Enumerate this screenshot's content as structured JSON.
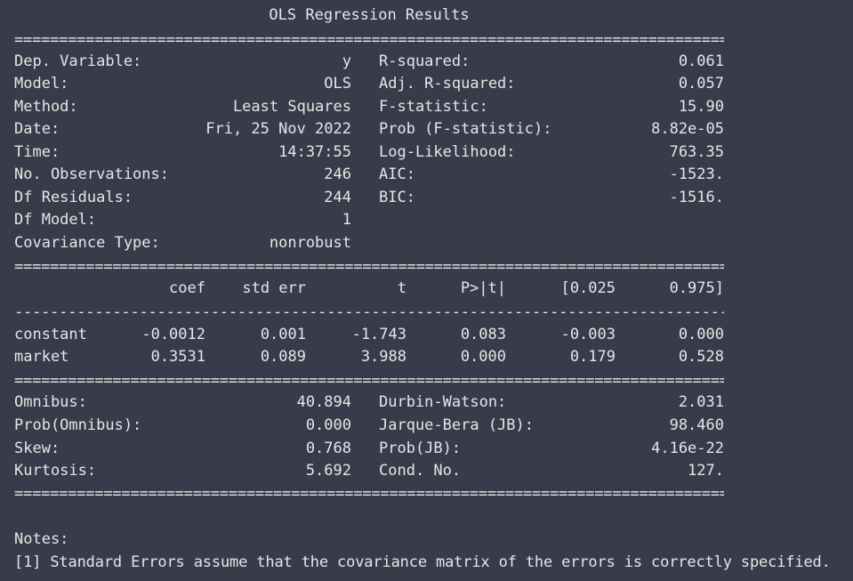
{
  "title": "OLS Regression Results",
  "rule_double": "===============================================================================================",
  "rule_single": "-----------------------------------------------------------------------------------------------",
  "summary_left": [
    {
      "label": "Dep. Variable:",
      "value": "y"
    },
    {
      "label": "Model:",
      "value": "OLS"
    },
    {
      "label": "Method:",
      "value": "Least Squares"
    },
    {
      "label": "Date:",
      "value": "Fri, 25 Nov 2022"
    },
    {
      "label": "Time:",
      "value": "14:37:55"
    },
    {
      "label": "No. Observations:",
      "value": "246"
    },
    {
      "label": "Df Residuals:",
      "value": "244"
    },
    {
      "label": "Df Model:",
      "value": "1"
    },
    {
      "label": "Covariance Type:",
      "value": "nonrobust"
    }
  ],
  "summary_right": [
    {
      "label": "R-squared:",
      "value": "0.061"
    },
    {
      "label": "Adj. R-squared:",
      "value": "0.057"
    },
    {
      "label": "F-statistic:",
      "value": "15.90"
    },
    {
      "label": "Prob (F-statistic):",
      "value": "8.82e-05"
    },
    {
      "label": "Log-Likelihood:",
      "value": "763.35"
    },
    {
      "label": "AIC:",
      "value": "-1523."
    },
    {
      "label": "BIC:",
      "value": "-1516."
    }
  ],
  "coef_table": {
    "headers": [
      "coef",
      "std err",
      "t",
      "P>|t|",
      "[0.025",
      "0.975]"
    ],
    "rows": [
      {
        "name": "constant",
        "values": [
          "-0.0012",
          "0.001",
          "-1.743",
          "0.083",
          "-0.003",
          "0.000"
        ]
      },
      {
        "name": "market",
        "values": [
          "0.3531",
          "0.089",
          "3.988",
          "0.000",
          "0.179",
          "0.528"
        ]
      }
    ]
  },
  "diagnostics_left": [
    {
      "label": "Omnibus:",
      "value": "40.894"
    },
    {
      "label": "Prob(Omnibus):",
      "value": "0.000"
    },
    {
      "label": "Skew:",
      "value": "0.768"
    },
    {
      "label": "Kurtosis:",
      "value": "5.692"
    }
  ],
  "diagnostics_right": [
    {
      "label": "Durbin-Watson:",
      "value": "2.031"
    },
    {
      "label": "Jarque-Bera (JB):",
      "value": "98.460"
    },
    {
      "label": "Prob(JB):",
      "value": "4.16e-22"
    },
    {
      "label": "Cond. No.",
      "value": "127."
    }
  ],
  "notes": {
    "heading": "Notes:",
    "items": [
      "[1] Standard Errors assume that the covariance matrix of the errors is correctly specified."
    ]
  }
}
